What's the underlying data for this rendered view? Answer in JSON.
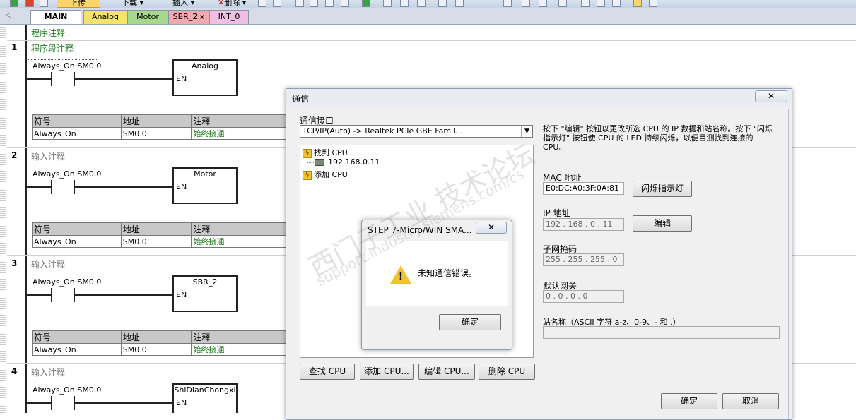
{
  "toolbar": {
    "upload_label": "上传",
    "download_label": "下载",
    "insert_label": "插入",
    "delete_label": "删除"
  },
  "tabs": [
    {
      "label": "MAIN"
    },
    {
      "label": "Analog"
    },
    {
      "label": "Motor"
    },
    {
      "label": "SBR_2",
      "close": "x"
    },
    {
      "label": "INT_0"
    }
  ],
  "tab_colors": {
    "MAIN": "#ffffff",
    "Analog": "#f5e36a",
    "Motor": "#a8d88c",
    "SBR_2": "#f4a8b0",
    "INT_0": "#f0bfe4"
  },
  "program_comment": "程序注释",
  "networks": [
    {
      "number": "1",
      "comment": "程序段注释",
      "contact": "Always_On:SM0.0",
      "block": "Analog"
    },
    {
      "number": "2",
      "comment": "输入注释",
      "contact": "Always_On:SM0.0",
      "block": "Motor"
    },
    {
      "number": "3",
      "comment": "输入注释",
      "contact": "Always_On:SM0.0",
      "block": "SBR_2"
    },
    {
      "number": "4",
      "comment": "输入注释",
      "contact": "Always_On:SM0.0",
      "block": "ShiDianChongxi"
    }
  ],
  "block_en": "EN",
  "symtable": {
    "headers": [
      "符号",
      "地址",
      "注释"
    ],
    "row": [
      "Always_On",
      "SM0.0",
      "始终接通"
    ]
  },
  "comm_dialog": {
    "title": "通信",
    "interface_label": "通信接口",
    "interface_value": "TCP/IP(Auto) -> Realtek PCIe GBE Famil...",
    "tree": {
      "found": "找到 CPU",
      "ip": "192.168.0.11",
      "add": "添加 CPU"
    },
    "info": "按下 \"编辑\" 按钮以更改所选 CPU 的 IP 数据和站名称。按下 \"闪烁指示灯\" 按钮使 CPU 的 LED 持续闪烁，以便目测找到连接的 CPU。",
    "mac_label": "MAC 地址",
    "mac_value": "E0:DC:A0:3F:0A:81",
    "blink_button": "闪烁指示灯",
    "ip_label": "IP 地址",
    "ip_value": "192 . 168 .  0  .  11",
    "edit_button": "编辑",
    "subnet_label": "子网掩码",
    "subnet_value": "255 . 255 . 255 .  0",
    "gateway_label": "默认网关",
    "gateway_value": " 0  .  0  .  0  .  0",
    "station_label": "站名称（ASCII 字符 a-z、0-9、- 和 .）",
    "station_value": "",
    "find_button": "查找 CPU",
    "addcpu_button": "添加 CPU...",
    "editcpu_button": "编辑 CPU...",
    "delcpu_button": "删除 CPU",
    "ok_button": "确定",
    "cancel_button": "取消"
  },
  "error_dialog": {
    "title": "STEP 7-Micro/WIN SMA...",
    "message": "未知通信错误。",
    "ok_button": "确定"
  },
  "watermark": {
    "cn": "西门子工业  技术论坛",
    "en": "support.industry.siemens.com/cs"
  }
}
